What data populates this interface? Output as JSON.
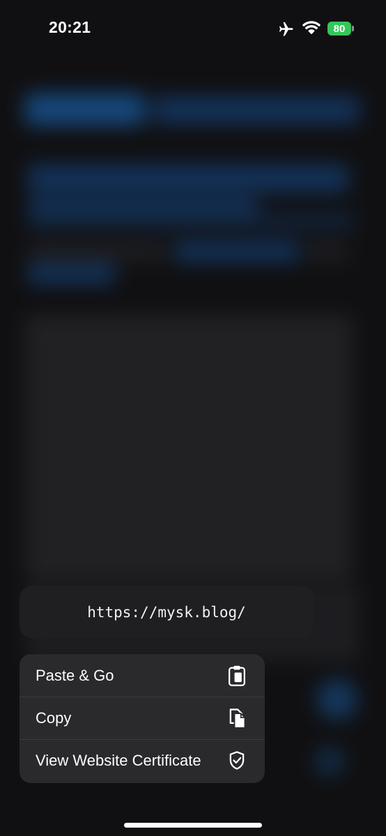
{
  "status_bar": {
    "time": "20:21",
    "battery_level": "80",
    "icons": [
      "airplane-icon",
      "wifi-icon",
      "battery-charging-icon"
    ],
    "battery_color": "#34c759"
  },
  "url_preview": {
    "url": "https://mysk.blog/"
  },
  "context_menu": {
    "items": [
      {
        "label": "Paste & Go",
        "icon": "paste-icon"
      },
      {
        "label": "Copy",
        "icon": "copy-icon"
      },
      {
        "label": "View Website Certificate",
        "icon": "shield-check-icon"
      }
    ]
  },
  "colors": {
    "background": "#151517",
    "menu_background": "#2a2a2d",
    "url_card_background": "#1f1f22"
  }
}
